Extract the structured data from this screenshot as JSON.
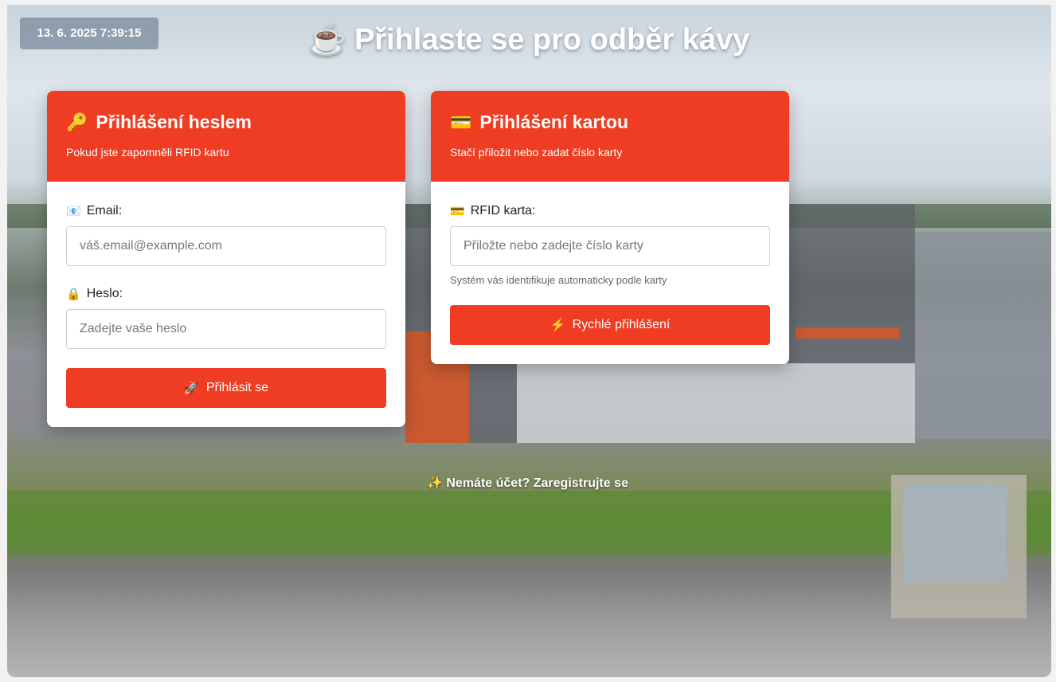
{
  "timestamp": "13. 6. 2025 7:39:15",
  "title": {
    "icon": "☕",
    "text": "Přihlaste se pro odběr kávy"
  },
  "password_card": {
    "icon": "🔑",
    "title": "Přihlášení heslem",
    "subtitle": "Pokud jste zapomněli RFID kartu",
    "email_icon": "📧",
    "email_label": "Email:",
    "email_placeholder": "váš.email@example.com",
    "password_icon": "🔒",
    "password_label": "Heslo:",
    "password_placeholder": "Zadejte vaše heslo",
    "submit_icon": "🚀",
    "submit_label": "Přihlásit se"
  },
  "card_card": {
    "icon": "💳",
    "title": "Přihlášení kartou",
    "subtitle": "Stačí přiložit nebo zadat číslo karty",
    "rfid_icon": "💳",
    "rfid_label": "RFID karta:",
    "rfid_placeholder": "Přiložte nebo zadejte číslo karty",
    "help": "Systém vás identifikuje automaticky podle karty",
    "submit_icon": "⚡",
    "submit_label": "Rychlé přihlášení"
  },
  "register": {
    "icon": "✨",
    "text": "Nemáte účet? Zaregistrujte se"
  },
  "colors": {
    "accent": "#ee3d22",
    "card_bg": "#ffffff"
  }
}
